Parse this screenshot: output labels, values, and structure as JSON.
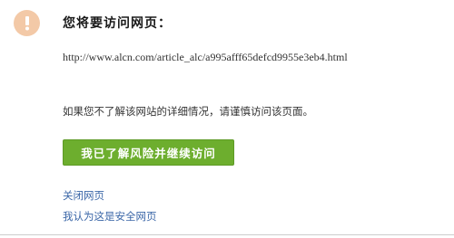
{
  "warning": {
    "icon": "exclamation-icon",
    "badge_color": "#f3c9a7"
  },
  "title": "您将要访问网页：",
  "url": "http://www.alcn.com/article_alc/a995afff65defcd9955e3eb4.html",
  "notice": "如果您不了解该网站的详细情况，请谨慎访问该页面。",
  "continue_button": {
    "label": "我已了解风险并继续访问",
    "color": "#6dae2e"
  },
  "links": {
    "close_page": "关闭网页",
    "mark_safe": "我认为这是安全网页",
    "color": "#3a66a7"
  }
}
